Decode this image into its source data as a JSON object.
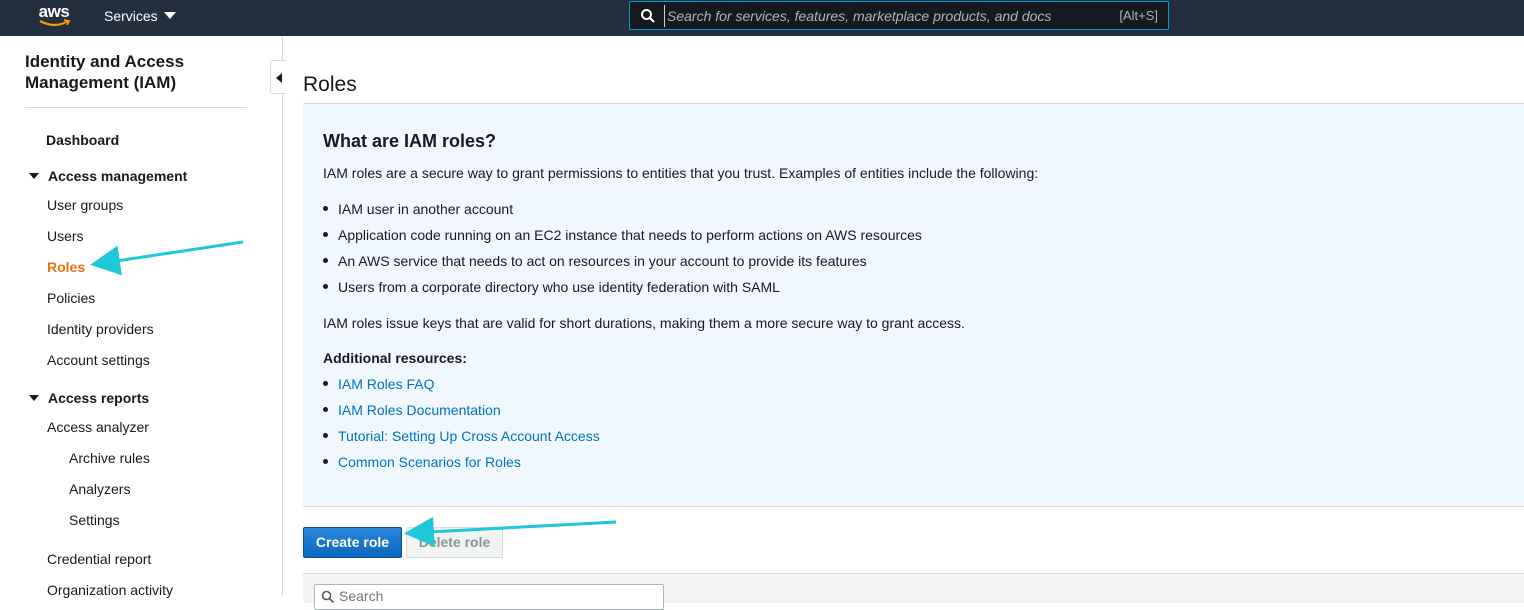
{
  "topnav": {
    "logo_text": "aws",
    "services_label": "Services",
    "search_placeholder": "Search for services, features, marketplace products, and docs",
    "search_shortcut": "[Alt+S]"
  },
  "sidebar": {
    "service_title": "Identity and Access Management (IAM)",
    "dashboard": "Dashboard",
    "access_management": {
      "label": "Access management",
      "items": [
        "User groups",
        "Users",
        "Roles",
        "Policies",
        "Identity providers",
        "Account settings"
      ]
    },
    "access_reports": {
      "label": "Access reports",
      "items": [
        "Access analyzer",
        "Archive rules",
        "Analyzers",
        "Settings",
        "Credential report",
        "Organization activity"
      ]
    },
    "active_item": "Roles"
  },
  "main": {
    "page_title": "Roles",
    "info": {
      "heading": "What are IAM roles?",
      "intro": "IAM roles are a secure way to grant permissions to entities that you trust. Examples of entities include the following:",
      "examples": [
        "IAM user in another account",
        "Application code running on an EC2 instance that needs to perform actions on AWS resources",
        "An AWS service that needs to act on resources in your account to provide its features",
        "Users from a corporate directory who use identity federation with SAML"
      ],
      "summary": "IAM roles issue keys that are valid for short durations, making them a more secure way to grant access.",
      "resources_label": "Additional resources:",
      "links": [
        "IAM Roles FAQ",
        "IAM Roles Documentation",
        "Tutorial: Setting Up Cross Account Access",
        "Common Scenarios for Roles"
      ]
    },
    "create_role_label": "Create role",
    "delete_role_label": "Delete role",
    "table_search_placeholder": "Search"
  },
  "colors": {
    "topnav_bg": "#232f3e",
    "active_nav": "#ec7211",
    "link": "#0073bb",
    "info_bg": "#f1f8fd",
    "primary_button": "#0f6fc6",
    "annotation_arrow": "#1ec8d6"
  }
}
